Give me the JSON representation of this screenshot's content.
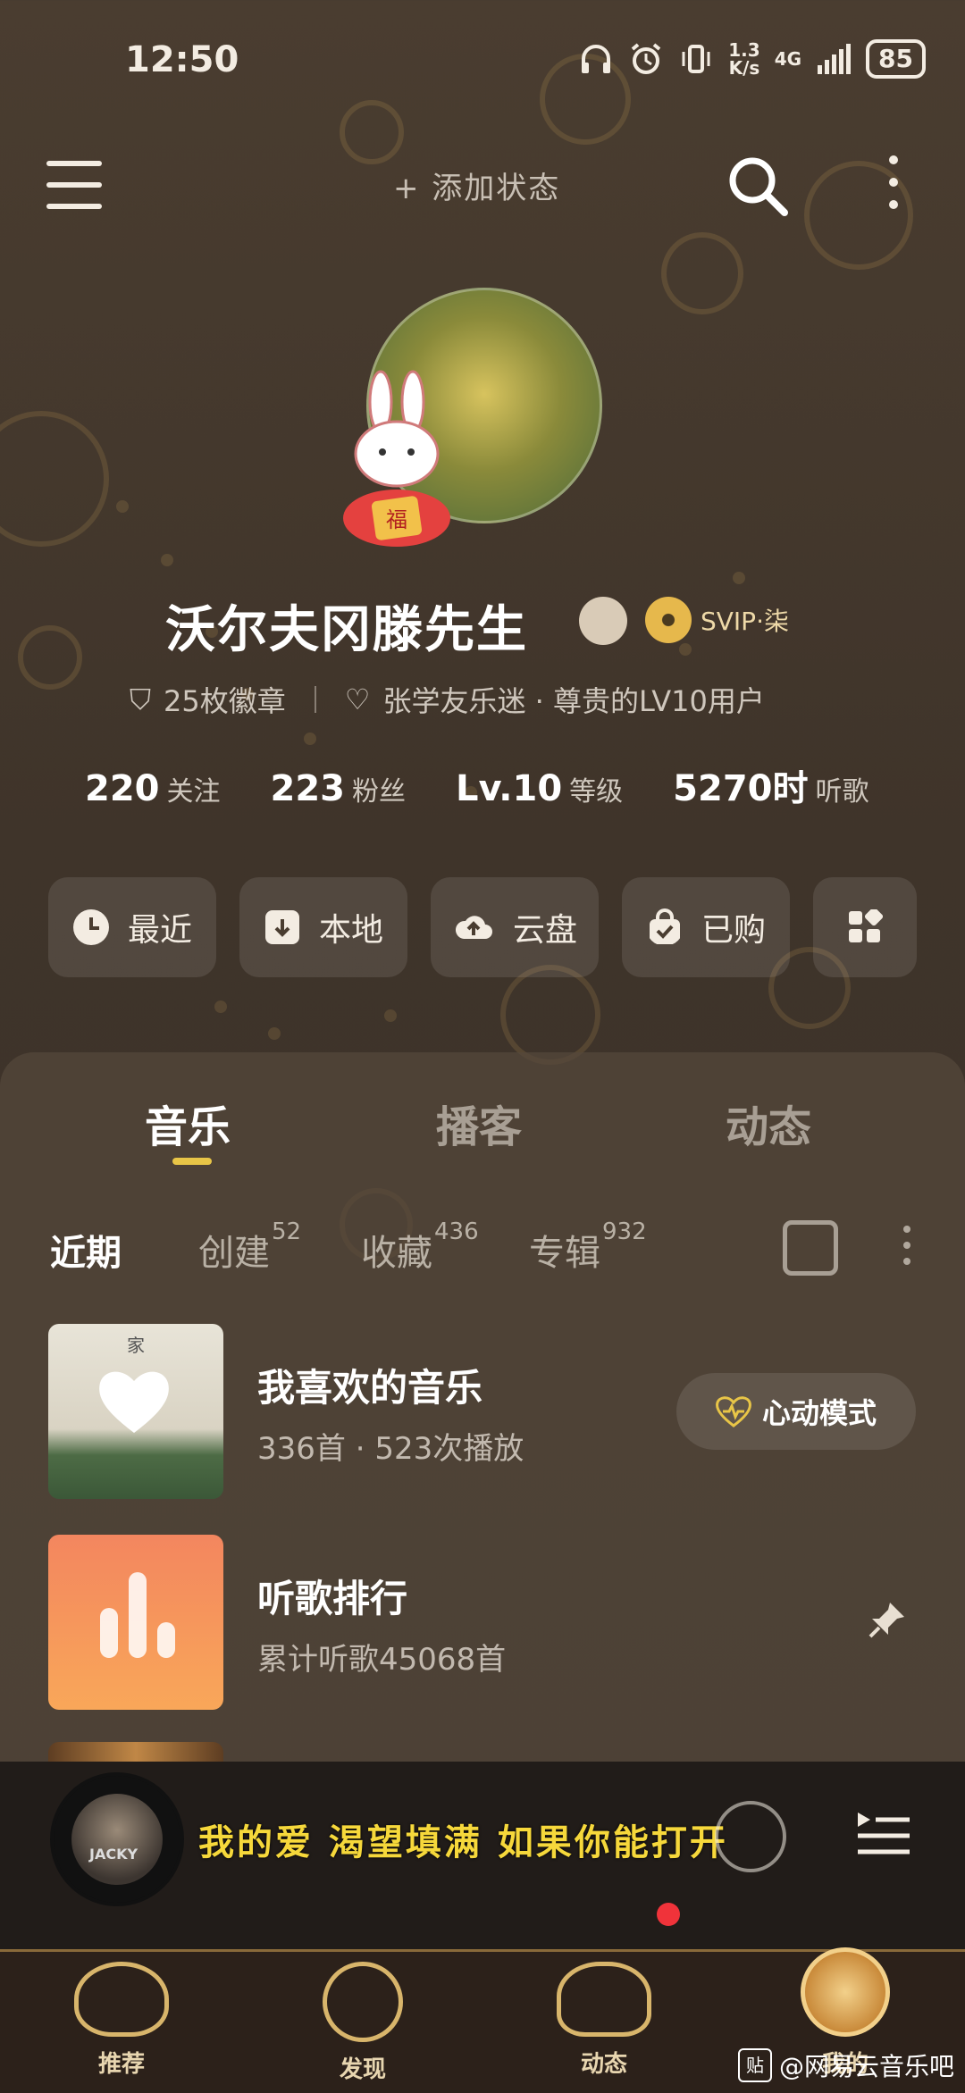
{
  "status_bar": {
    "time": "12:50",
    "net_speed_top": "1.3",
    "net_speed_bottom": "K/s",
    "net_type": "4G",
    "battery": "85"
  },
  "header": {
    "add_status": "+ 添加状态"
  },
  "profile": {
    "username": "沃尔夫冈滕先生",
    "svip_label": "SVIP·柒",
    "badges": "25枚徽章",
    "fan_tag": "张学友乐迷 · 尊贵的LV10用户",
    "stats": [
      {
        "num": "220",
        "label": "关注"
      },
      {
        "num": "223",
        "label": "粉丝"
      },
      {
        "num": "Lv.10",
        "label": "等级"
      },
      {
        "num": "5270时",
        "label": "听歌"
      }
    ]
  },
  "quick_actions": [
    {
      "label": "最近",
      "icon": "clock-icon"
    },
    {
      "label": "本地",
      "icon": "download-box-icon"
    },
    {
      "label": "云盘",
      "icon": "cloud-upload-icon"
    },
    {
      "label": "已购",
      "icon": "shopping-bag-icon"
    },
    {
      "label": "",
      "icon": "grid-apps-icon"
    }
  ],
  "tabs": {
    "music": "音乐",
    "podcast": "播客",
    "moments": "动态"
  },
  "subtabs": {
    "recent": "近期",
    "created": "创建",
    "created_count": "52",
    "collected": "收藏",
    "collected_count": "436",
    "albums": "专辑",
    "albums_count": "932"
  },
  "playlists": [
    {
      "title": "我喜欢的音乐",
      "subtitle": "336首 · 523次播放",
      "action": "心动模式",
      "cover_text": "家"
    },
    {
      "title": "听歌排行",
      "subtitle": "累计听歌45068首"
    }
  ],
  "player": {
    "lyric": "我的爱 渴望填满 如果你能打开",
    "cover_text": "JACKY"
  },
  "nav": [
    {
      "label": "推荐",
      "icon": "ingot-icon"
    },
    {
      "label": "发现",
      "icon": "compass-star-icon"
    },
    {
      "label": "动态",
      "icon": "cloud-icon"
    },
    {
      "label": "我的",
      "icon": "coin-flower-icon"
    }
  ],
  "watermark": "@网易云音乐吧",
  "watermark_badge": "贴",
  "colors": {
    "accent": "#e8c547",
    "lyric": "#f6d83b",
    "badge_dot": "#f0333a"
  }
}
